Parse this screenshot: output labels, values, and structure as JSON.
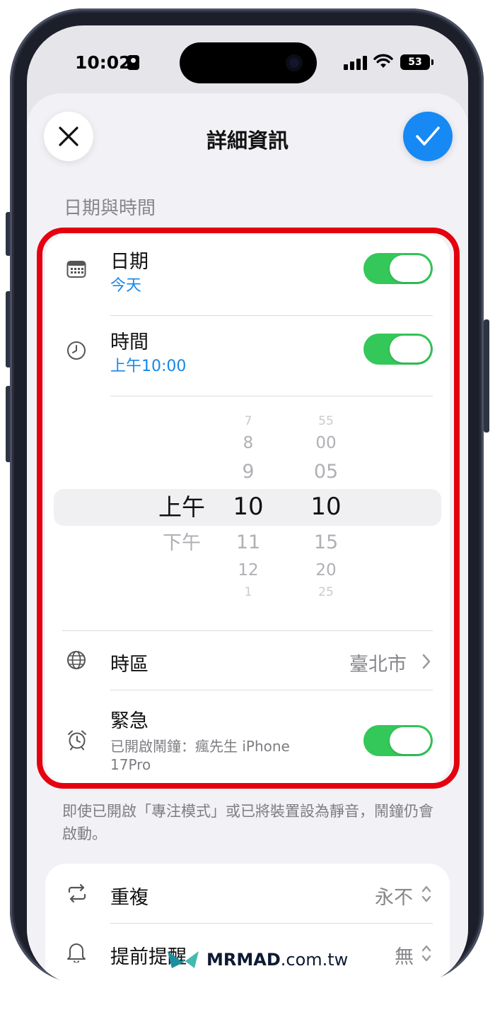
{
  "status_bar": {
    "time": "10:02",
    "battery": "53"
  },
  "sheet": {
    "title": "詳細資訊"
  },
  "section": {
    "header": "日期與時間"
  },
  "rows": {
    "date": {
      "title": "日期",
      "value": "今天",
      "enabled": true
    },
    "time": {
      "title": "時間",
      "value": "上午10:00",
      "enabled": true
    },
    "timezone": {
      "title": "時區",
      "value": "臺北市"
    },
    "urgent": {
      "title": "緊急",
      "subtitle_line1": "已開啟鬧鐘：瘋先生 iPhone",
      "subtitle_line2": "17Pro",
      "enabled": true
    }
  },
  "picker": {
    "ampm": {
      "selected": "上午",
      "next": "下午"
    },
    "hours": {
      "faint_top": "7",
      "above2": "8",
      "above1": "9",
      "selected": "10",
      "below1": "11",
      "below2": "12",
      "faint_bottom": "1"
    },
    "minutes": {
      "faint_top": "55",
      "above2": "00",
      "above1": "05",
      "selected": "10",
      "below1": "15",
      "below2": "20",
      "faint_bottom": "25"
    }
  },
  "footer_note": "即使已開啟「專注模式」或已將裝置設為靜音，鬧鐘仍會啟動。",
  "options": {
    "repeat": {
      "title": "重複",
      "value": "永不"
    },
    "early_reminder": {
      "title": "提前提醒",
      "value": "無"
    }
  },
  "watermark": {
    "brand": "MRMAD",
    "domain": ".com.tw"
  },
  "colors": {
    "accent": "#1689f5",
    "toggle_on": "#34c759",
    "highlight": "#e4000f"
  }
}
